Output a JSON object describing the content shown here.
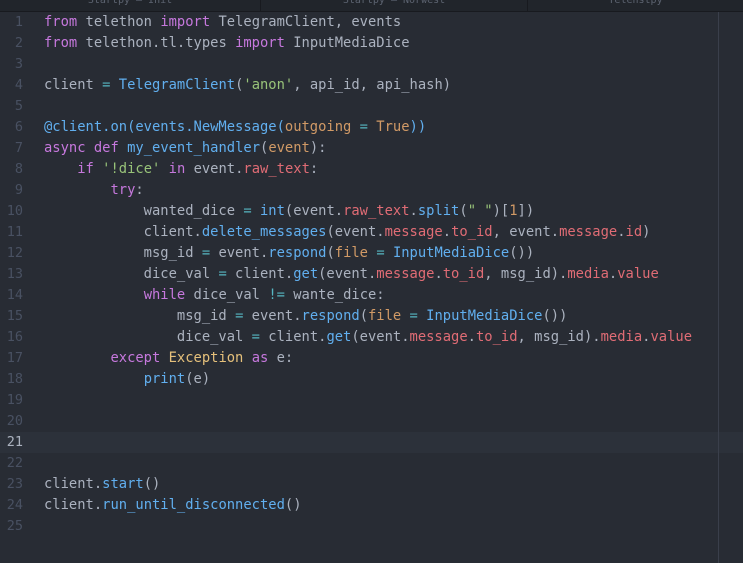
{
  "tabs": [
    "Startpy — Init",
    "Startpy — Norwest",
    "Telenstpy"
  ],
  "editor": {
    "cursor_line": 21,
    "lines": [
      {
        "number": "1",
        "tokens": [
          [
            "k",
            "from"
          ],
          [
            "t",
            " telethon "
          ],
          [
            "k",
            "import"
          ],
          [
            "t",
            " TelegramClient, events"
          ]
        ]
      },
      {
        "number": "2",
        "tokens": [
          [
            "k",
            "from"
          ],
          [
            "t",
            " telethon.tl.types "
          ],
          [
            "k",
            "import"
          ],
          [
            "t",
            " InputMediaDice"
          ]
        ]
      },
      {
        "number": "3",
        "tokens": []
      },
      {
        "number": "4",
        "tokens": [
          [
            "t",
            "client "
          ],
          [
            "o",
            "="
          ],
          [
            "t",
            " "
          ],
          [
            "f",
            "TelegramClient"
          ],
          [
            "t",
            "("
          ],
          [
            "s",
            "'anon'"
          ],
          [
            "t",
            ", api_id, api_hash)"
          ]
        ]
      },
      {
        "number": "5",
        "tokens": []
      },
      {
        "number": "6",
        "tokens": [
          [
            "d",
            "@client.on(events.NewMessage("
          ],
          [
            "n",
            "outgoing"
          ],
          [
            "d",
            " "
          ],
          [
            "o",
            "="
          ],
          [
            "d",
            " "
          ],
          [
            "n",
            "True"
          ],
          [
            "d",
            "))"
          ]
        ]
      },
      {
        "number": "7",
        "tokens": [
          [
            "k",
            "async"
          ],
          [
            "t",
            " "
          ],
          [
            "k",
            "def"
          ],
          [
            "t",
            " "
          ],
          [
            "f",
            "my_event_handler"
          ],
          [
            "t",
            "("
          ],
          [
            "n",
            "event"
          ],
          [
            "t",
            "):"
          ]
        ]
      },
      {
        "number": "8",
        "tokens": [
          [
            "t",
            "    "
          ],
          [
            "k",
            "if"
          ],
          [
            "t",
            " "
          ],
          [
            "s",
            "'!dice'"
          ],
          [
            "t",
            " "
          ],
          [
            "k",
            "in"
          ],
          [
            "t",
            " event."
          ],
          [
            "p",
            "raw_text"
          ],
          [
            "t",
            ":"
          ]
        ]
      },
      {
        "number": "9",
        "tokens": [
          [
            "t",
            "        "
          ],
          [
            "k",
            "try"
          ],
          [
            "t",
            ":"
          ]
        ]
      },
      {
        "number": "10",
        "tokens": [
          [
            "t",
            "            wanted_dice "
          ],
          [
            "o",
            "="
          ],
          [
            "t",
            " "
          ],
          [
            "f",
            "int"
          ],
          [
            "t",
            "(event."
          ],
          [
            "p",
            "raw_text"
          ],
          [
            "t",
            "."
          ],
          [
            "f",
            "split"
          ],
          [
            "t",
            "("
          ],
          [
            "s",
            "\" \""
          ],
          [
            "t",
            ")["
          ],
          [
            "n",
            "1"
          ],
          [
            "t",
            "])"
          ]
        ]
      },
      {
        "number": "11",
        "tokens": [
          [
            "t",
            "            client."
          ],
          [
            "f",
            "delete_messages"
          ],
          [
            "t",
            "(event."
          ],
          [
            "p",
            "message"
          ],
          [
            "t",
            "."
          ],
          [
            "p",
            "to_id"
          ],
          [
            "t",
            ", event."
          ],
          [
            "p",
            "message"
          ],
          [
            "t",
            "."
          ],
          [
            "p",
            "id"
          ],
          [
            "t",
            ")"
          ]
        ]
      },
      {
        "number": "12",
        "tokens": [
          [
            "t",
            "            msg_id "
          ],
          [
            "o",
            "="
          ],
          [
            "t",
            " event."
          ],
          [
            "f",
            "respond"
          ],
          [
            "t",
            "("
          ],
          [
            "n",
            "file"
          ],
          [
            "t",
            " "
          ],
          [
            "o",
            "="
          ],
          [
            "t",
            " "
          ],
          [
            "f",
            "InputMediaDice"
          ],
          [
            "t",
            "())"
          ]
        ]
      },
      {
        "number": "13",
        "tokens": [
          [
            "t",
            "            dice_val "
          ],
          [
            "o",
            "="
          ],
          [
            "t",
            " client."
          ],
          [
            "f",
            "get"
          ],
          [
            "t",
            "(event."
          ],
          [
            "p",
            "message"
          ],
          [
            "t",
            "."
          ],
          [
            "p",
            "to_id"
          ],
          [
            "t",
            ", msg_id)."
          ],
          [
            "p",
            "media"
          ],
          [
            "t",
            "."
          ],
          [
            "p",
            "value"
          ]
        ]
      },
      {
        "number": "14",
        "tokens": [
          [
            "t",
            "            "
          ],
          [
            "k",
            "while"
          ],
          [
            "t",
            " dice_val "
          ],
          [
            "o",
            "!="
          ],
          [
            "t",
            " wante_dice:"
          ]
        ]
      },
      {
        "number": "15",
        "tokens": [
          [
            "t",
            "                msg_id "
          ],
          [
            "o",
            "="
          ],
          [
            "t",
            " event."
          ],
          [
            "f",
            "respond"
          ],
          [
            "t",
            "("
          ],
          [
            "n",
            "file"
          ],
          [
            "t",
            " "
          ],
          [
            "o",
            "="
          ],
          [
            "t",
            " "
          ],
          [
            "f",
            "InputMediaDice"
          ],
          [
            "t",
            "())"
          ]
        ]
      },
      {
        "number": "16",
        "tokens": [
          [
            "t",
            "                dice_val "
          ],
          [
            "o",
            "="
          ],
          [
            "t",
            " client."
          ],
          [
            "f",
            "get"
          ],
          [
            "t",
            "(event."
          ],
          [
            "p",
            "message"
          ],
          [
            "t",
            "."
          ],
          [
            "p",
            "to_id"
          ],
          [
            "t",
            ", msg_id)."
          ],
          [
            "p",
            "media"
          ],
          [
            "t",
            "."
          ],
          [
            "p",
            "value"
          ]
        ]
      },
      {
        "number": "17",
        "tokens": [
          [
            "t",
            "        "
          ],
          [
            "k",
            "except"
          ],
          [
            "t",
            " "
          ],
          [
            "c",
            "Exception"
          ],
          [
            "t",
            " "
          ],
          [
            "k",
            "as"
          ],
          [
            "t",
            " e:"
          ]
        ]
      },
      {
        "number": "18",
        "tokens": [
          [
            "t",
            "            "
          ],
          [
            "f",
            "print"
          ],
          [
            "t",
            "(e)"
          ]
        ]
      },
      {
        "number": "19",
        "tokens": []
      },
      {
        "number": "20",
        "tokens": []
      },
      {
        "number": "21",
        "tokens": []
      },
      {
        "number": "22",
        "tokens": []
      },
      {
        "number": "23",
        "tokens": [
          [
            "t",
            "client."
          ],
          [
            "f",
            "start"
          ],
          [
            "t",
            "()"
          ]
        ]
      },
      {
        "number": "24",
        "tokens": [
          [
            "t",
            "client."
          ],
          [
            "f",
            "run_until_disconnected"
          ],
          [
            "t",
            "()"
          ]
        ]
      },
      {
        "number": "25",
        "tokens": []
      }
    ]
  },
  "colors": {
    "background": "#282c34",
    "keyword": "#c678dd",
    "function": "#61afef",
    "string": "#98c379",
    "property": "#e06c75",
    "number_param": "#d19a66",
    "class": "#e5c07b",
    "operator": "#56b6c2",
    "plain": "#abb2bf"
  }
}
